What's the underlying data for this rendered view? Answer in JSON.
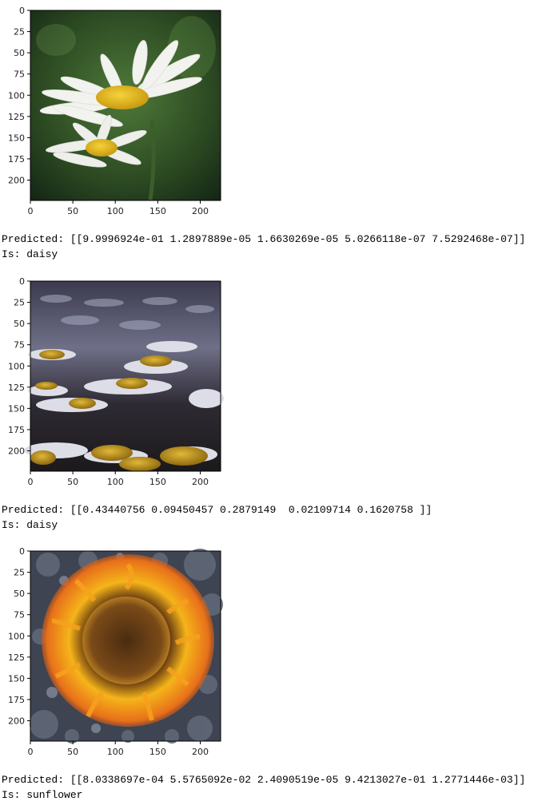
{
  "cells": [
    {
      "image_desc": "daisy-closeup",
      "axes": {
        "xticks": [
          "0",
          "50",
          "100",
          "150",
          "200"
        ],
        "yticks": [
          "0",
          "25",
          "50",
          "75",
          "100",
          "125",
          "150",
          "175",
          "200"
        ]
      },
      "predicted_line": "Predicted: [[9.9996924e-01 1.2897889e-05 1.6630269e-05 5.0266118e-07 7.5292468e-07]]",
      "is_line": "Is: daisy"
    },
    {
      "image_desc": "daisy-field",
      "axes": {
        "xticks": [
          "0",
          "50",
          "100",
          "150",
          "200"
        ],
        "yticks": [
          "0",
          "25",
          "50",
          "75",
          "100",
          "125",
          "150",
          "175",
          "200"
        ]
      },
      "predicted_line": "Predicted: [[0.43440756 0.09450457 0.2879149  0.02109714 0.1620758 ]]",
      "is_line": "Is: daisy"
    },
    {
      "image_desc": "sunflower-art",
      "axes": {
        "xticks": [
          "0",
          "50",
          "100",
          "150",
          "200"
        ],
        "yticks": [
          "0",
          "25",
          "50",
          "75",
          "100",
          "125",
          "150",
          "175",
          "200"
        ]
      },
      "predicted_line": "Predicted: [[8.0338697e-04 5.5765092e-02 2.4090519e-05 9.4213027e-01 1.2771446e-03]]",
      "is_line": "Is: sunflower"
    }
  ]
}
